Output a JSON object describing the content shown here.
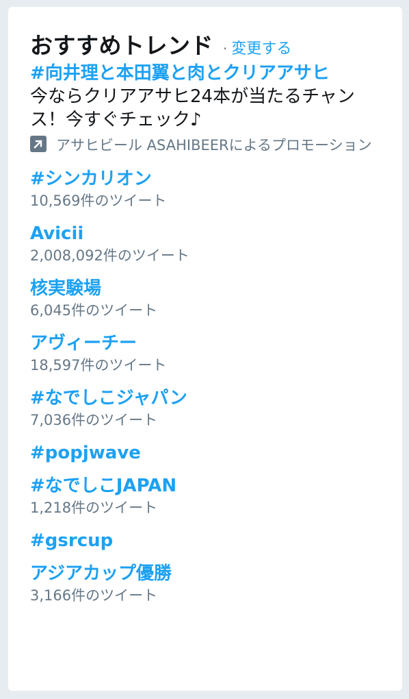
{
  "header": {
    "title": "おすすめトレンド",
    "separator": "·",
    "change_label": "変更する"
  },
  "promoted": {
    "name": "#向井理と本田翼と肉とクリアアサヒ",
    "description": "今ならクリアアサヒ24本が当たるチャンス！今すぐチェック♪",
    "promoted_by": "アサヒビール ASAHIBEERによるプロモーション",
    "icon": "promoted-arrow-icon"
  },
  "trends": [
    {
      "name": "#シンカリオン",
      "count": "10,569件のツイート"
    },
    {
      "name": "Avicii",
      "count": "2,008,092件のツイート"
    },
    {
      "name": "核実験場",
      "count": "6,045件のツイート"
    },
    {
      "name": "アヴィーチー",
      "count": "18,597件のツイート"
    },
    {
      "name": "#なでしこジャパン",
      "count": "7,036件のツイート"
    },
    {
      "name": "#popjwave",
      "count": ""
    },
    {
      "name": "#なでしこJAPAN",
      "count": "1,218件のツイート"
    },
    {
      "name": "#gsrcup",
      "count": ""
    },
    {
      "name": "アジアカップ優勝",
      "count": "3,166件のツイート"
    }
  ],
  "colors": {
    "link": "#1da1f2",
    "text": "#14171a",
    "muted": "#657786",
    "background": "#e6ecf0"
  }
}
